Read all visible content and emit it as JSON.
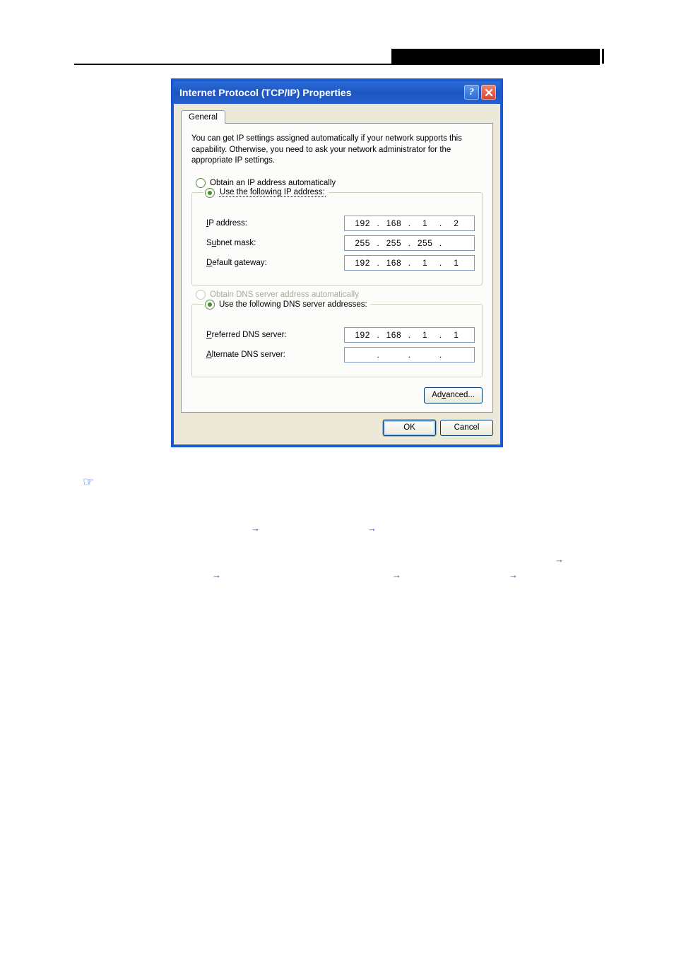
{
  "dialog": {
    "title": "Internet Protocol (TCP/IP) Properties",
    "tab": "General",
    "description": "You can get IP settings assigned automatically if your network supports this capability. Otherwise, you need to ask your network administrator for the appropriate IP settings.",
    "ip_section": {
      "auto_label": "Obtain an IP address automatically",
      "manual_label": "Use the following IP address:",
      "selected": "manual",
      "fields": {
        "ip_label": "IP address:",
        "ip_value": [
          "192",
          "168",
          "1",
          "2"
        ],
        "subnet_label": "Subnet mask:",
        "subnet_value": [
          "255",
          "255",
          "255",
          ""
        ],
        "gateway_label": "Default gateway:",
        "gateway_value": [
          "192",
          "168",
          "1",
          "1"
        ]
      }
    },
    "dns_section": {
      "auto_label": "Obtain DNS server address automatically",
      "manual_label": "Use the following DNS server addresses:",
      "selected": "manual",
      "auto_disabled": true,
      "fields": {
        "preferred_label": "Preferred DNS server:",
        "preferred_value": [
          "192",
          "168",
          "1",
          "1"
        ],
        "alternate_label": "Alternate DNS server:",
        "alternate_value": [
          "",
          "",
          "",
          ""
        ]
      }
    },
    "buttons": {
      "advanced": "Advanced...",
      "ok": "OK",
      "cancel": "Cancel"
    }
  },
  "icons": {
    "hand": "☞",
    "arrow": "→"
  }
}
